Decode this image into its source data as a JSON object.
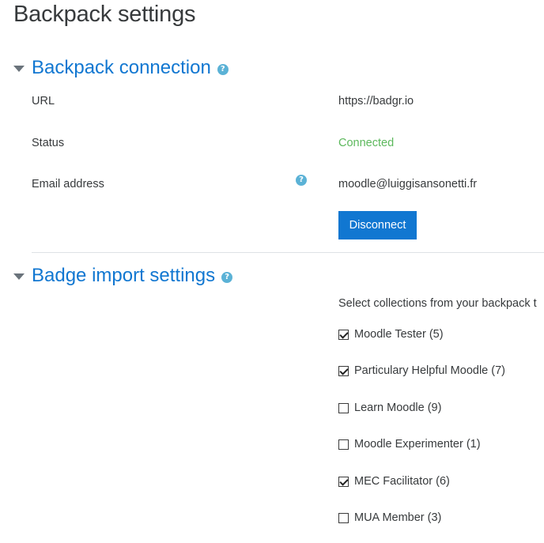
{
  "page": {
    "title": "Backpack settings"
  },
  "connection": {
    "title": "Backpack connection",
    "help_icon": "question-circle-icon",
    "url_label": "URL",
    "url_value": "https://badgr.io",
    "status_label": "Status",
    "status_value": "Connected",
    "status_color": "#5cb85c",
    "email_label": "Email address",
    "email_value": "moodle@luiggisansonetti.fr",
    "disconnect_label": "Disconnect"
  },
  "import": {
    "title": "Badge import settings",
    "help_icon": "question-circle-icon",
    "intro": "Select collections from your backpack t",
    "collections": [
      {
        "label": "Moodle Tester (5)",
        "checked": true
      },
      {
        "label": "Particulary Helpful Moodle (7)",
        "checked": true
      },
      {
        "label": "Learn Moodle (9)",
        "checked": false
      },
      {
        "label": "Moodle Experimenter (1)",
        "checked": false
      },
      {
        "label": "MEC Facilitator (6)",
        "checked": true
      },
      {
        "label": "MUA Member (3)",
        "checked": false
      }
    ]
  },
  "colors": {
    "accent": "#1177d1",
    "help": "#5bb2d6"
  }
}
